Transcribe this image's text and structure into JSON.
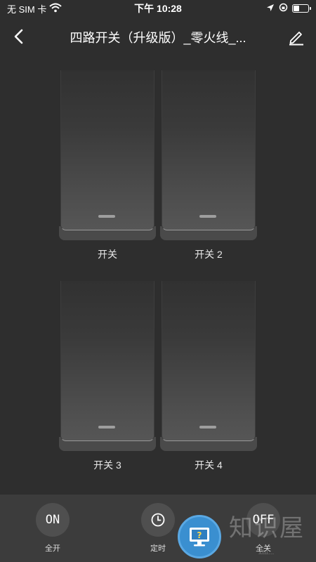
{
  "status_bar": {
    "carrier": "无 SIM 卡",
    "time": "下午 10:28"
  },
  "header": {
    "title": "四路开关（升级版）_零火线_..."
  },
  "switches": [
    {
      "label": "开关"
    },
    {
      "label": "开关 2"
    },
    {
      "label": "开关 3"
    },
    {
      "label": "开关 4"
    }
  ],
  "bottom_actions": {
    "all_on": {
      "icon_text": "ON",
      "label": "全开"
    },
    "timer": {
      "label": "定时"
    },
    "all_off": {
      "icon_text": "OFF",
      "label": "全关"
    }
  },
  "watermark": {
    "main": "知识屋",
    "sub": "xhl..."
  },
  "colors": {
    "background": "#2e2e2e",
    "bottom_bar": "#3c3c3c",
    "help_badge": "#3a8fd0"
  },
  "icons": [
    "wifi-icon",
    "location-icon",
    "lock-rotation-icon",
    "battery-icon",
    "back-chevron-icon",
    "edit-pencil-icon",
    "clock-icon",
    "help-monitor-icon"
  ]
}
